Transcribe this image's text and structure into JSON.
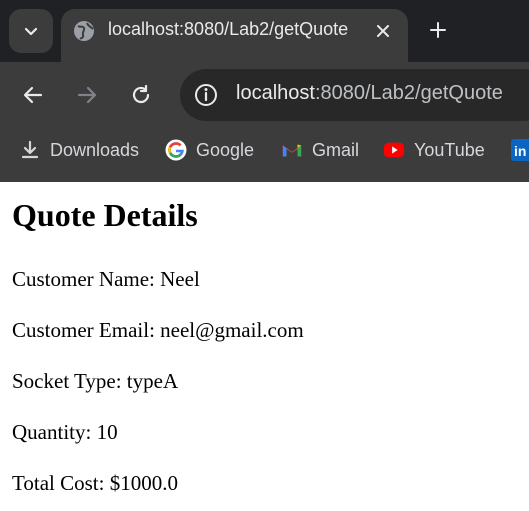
{
  "browser": {
    "tab_title": "localhost:8080/Lab2/getQuote",
    "url_host": "localhost",
    "url_rest": ":8080/Lab2/getQuote",
    "bookmarks": [
      {
        "label": "Downloads",
        "icon": "download-icon"
      },
      {
        "label": "Google",
        "icon": "google-icon"
      },
      {
        "label": "Gmail",
        "icon": "gmail-icon"
      },
      {
        "label": "YouTube",
        "icon": "youtube-icon"
      },
      {
        "label": "",
        "icon": "linkedin-icon"
      }
    ],
    "colors": {
      "tabstrip": "#202124",
      "toolbar": "#3c3c3c",
      "omnibox": "#282828",
      "text": "#e8eaed"
    }
  },
  "page": {
    "heading": "Quote Details",
    "customer_name": "Customer Name: Neel",
    "customer_email": "Customer Email: neel@gmail.com",
    "socket_type": "Socket Type: typeA",
    "quantity": "Quantity: 10",
    "total_cost": "Total Cost: $1000.0"
  }
}
